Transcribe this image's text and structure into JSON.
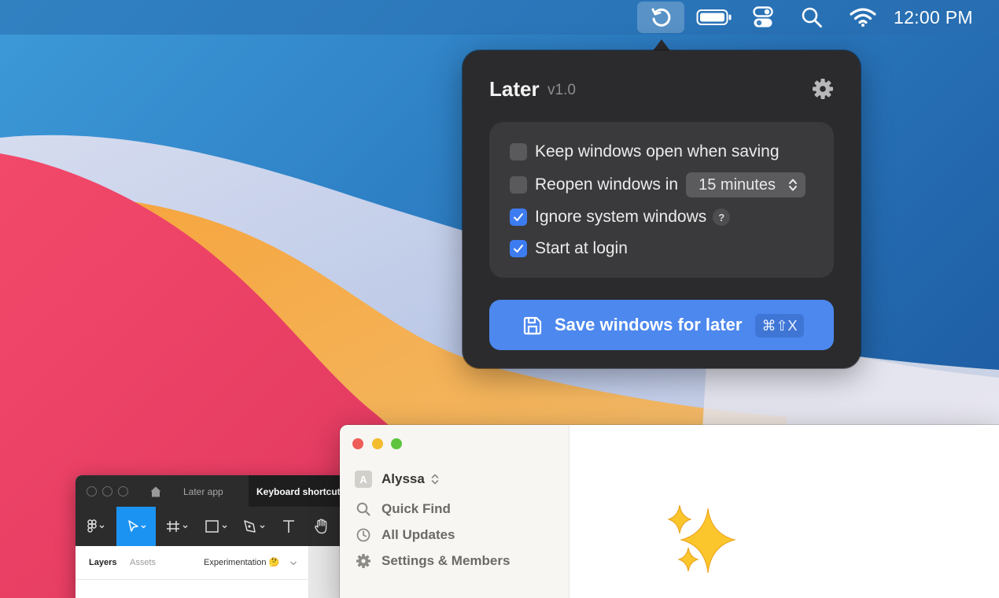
{
  "menubar": {
    "later_icon": "restore-arrow-icon",
    "battery_icon": "battery-icon",
    "control_center_icon": "control-center-icon",
    "search_icon": "search-icon",
    "wifi_icon": "wifi-icon",
    "clock": "12:00 PM"
  },
  "popover": {
    "title": "Later",
    "version": "v1.0",
    "settings_icon": "gear-icon",
    "options": [
      {
        "label": "Keep windows open when saving",
        "checked": false
      },
      {
        "label": "Reopen windows in",
        "checked": false
      },
      {
        "label": "Ignore system windows",
        "checked": true
      },
      {
        "label": "Start at login",
        "checked": true
      }
    ],
    "reopen_select": {
      "value": "15 minutes"
    },
    "help_label": "?",
    "save_button": {
      "label": "Save windows for later",
      "shortcut": "⌘⇧X",
      "icon": "floppy-disk-icon"
    }
  },
  "figma": {
    "tabs": [
      "Later app",
      "Keyboard shortcuts"
    ],
    "panel": {
      "layers": "Layers",
      "assets": "Assets",
      "page": "Experimentation 🤔"
    },
    "accent": "#1b93f3"
  },
  "notion": {
    "workspace": {
      "avatar": "A",
      "name": "Alyssa"
    },
    "items": [
      {
        "label": "Quick Find",
        "icon": "search-icon"
      },
      {
        "label": "All Updates",
        "icon": "clock-icon"
      },
      {
        "label": "Settings & Members",
        "icon": "gear-icon"
      }
    ],
    "content_icon": "sparkles-icon"
  },
  "colors": {
    "popover_bg": "#2b2b2d",
    "card_bg": "#3a3a3c",
    "accent_blue": "#4c88ee",
    "checkbox_on": "#3d7cf0"
  }
}
